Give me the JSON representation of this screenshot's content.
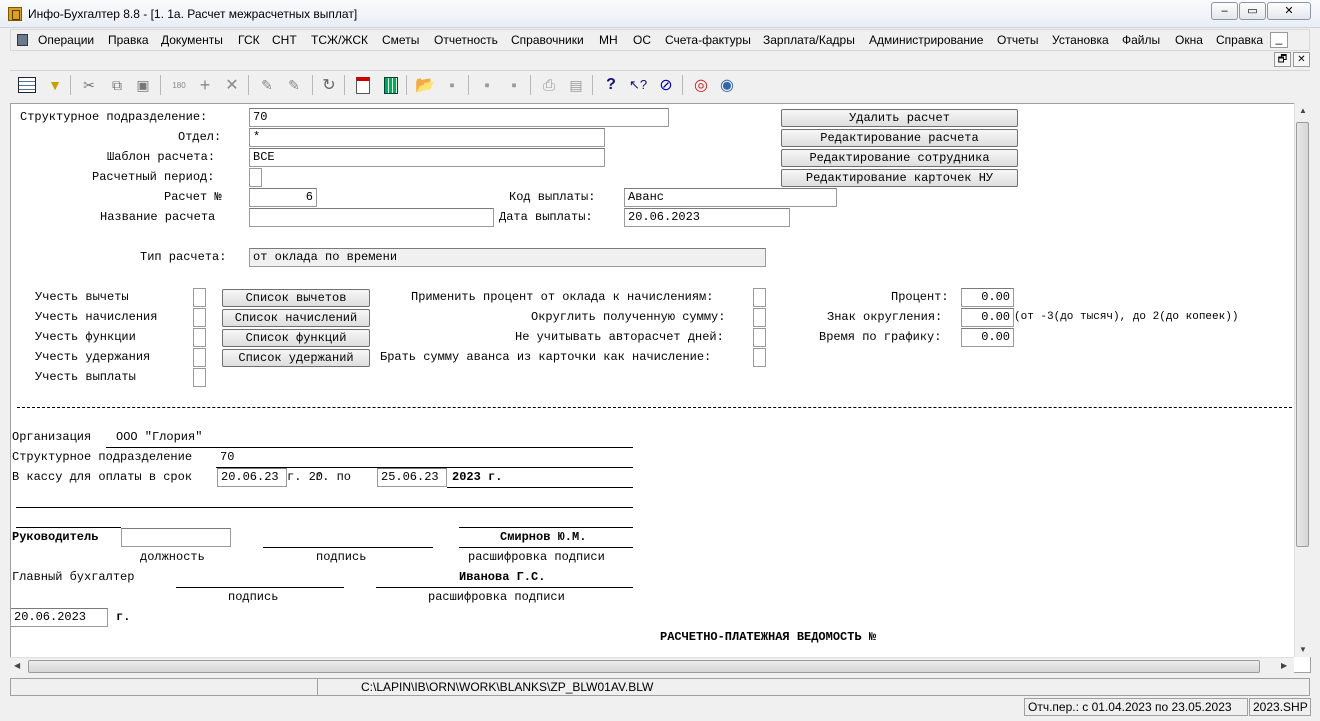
{
  "window": {
    "title": "Инфо-Бухгалтер 8.8 - [1. 1а. Расчет межрасчетных выплат]"
  },
  "menu": [
    "Операции",
    "Правка",
    "Документы",
    "ГСК",
    "СНТ",
    "ТСЖ/ЖСК",
    "Сметы",
    "Отчетность",
    "Справочники",
    "МН",
    "ОС",
    "Счета-фактуры",
    "Зарплата/Кадры",
    "Администрирование",
    "Отчеты",
    "Установка",
    "Файлы",
    "Окна",
    "Справка"
  ],
  "form": {
    "struct_label": "Структурное подразделение:",
    "struct_value": "70",
    "dept_label": "Отдел:",
    "dept_value": "*",
    "template_label": "Шаблон расчета:",
    "template_value": "ВСЕ",
    "period_label": "Расчетный период:",
    "calc_no_label": "Расчет №",
    "calc_no_value": "6",
    "calc_name_label": "Название расчета",
    "calc_name_value": "",
    "pay_code_label": "Код выплаты:",
    "pay_code_value": "Аванс",
    "pay_date_label": "Дата выплаты:",
    "pay_date_value": "20.06.2023",
    "calc_type_label": "Тип расчета:",
    "calc_type_value": "от оклада по времени",
    "opt_deductions": "Учесть вычеты",
    "opt_accruals": "Учесть начисления",
    "opt_functions": "Учесть функции",
    "opt_withholdings": "Учесть удержания",
    "opt_payments": "Учесть выплаты",
    "btn_deductions": "Список вычетов",
    "btn_accruals": "Список начислений",
    "btn_functions": "Список функций",
    "btn_withholdings": "Список удержаний",
    "apply_percent_label": "Применить процент от оклада к начислениям:",
    "round_sum_label": "Округлить полученную сумму:",
    "no_autocalc_label": "Не учитывать авторасчет дней:",
    "advance_card_label": "Брать сумму аванса из карточки как начисление:",
    "percent_label": "Процент:",
    "percent_value": "0.00",
    "round_sign_label": "Знак округления:",
    "round_sign_value": "0.00",
    "round_hint": "(от -3(до тысяч), до 2(до копеек))",
    "schedule_label": "Время по графику:",
    "schedule_value": "0.00",
    "btn_delete": "Удалить расчет",
    "btn_edit_calc": "Редактирование расчета",
    "btn_edit_emp": "Редактирование сотрудника",
    "btn_edit_cards": "Редактирование карточек НУ"
  },
  "blank": {
    "org_label": "Организация",
    "org_value": "ООО \"Глория\"",
    "struct_label": "Структурное подразделение",
    "struct_value": "70",
    "cash_label": "В кассу для оплаты в срок",
    "date_from": "20.06.23",
    "date_from_suffix": "г. 20",
    "date_mid": "по",
    "date_mid2": "г. по",
    "date_to": "25.06.23",
    "year_value": "2023 г.",
    "head_label": "Руководитель",
    "head_name": "Смирнов Ю.М.",
    "cap_position": "должность",
    "cap_signature": "подпись",
    "cap_decode": "расшифровка подписи",
    "chief_label": "Главный бухгалтер",
    "chief_name": "Иванова Г.С.",
    "cap_signature2": "подпись",
    "cap_decode2": "расшифровка подписи",
    "sign_date": "20.06.2023",
    "sign_date_suffix": "г.",
    "statement_title": "РАСЧЕТНО-ПЛАТЕЖНАЯ ВЕДОМОСТЬ №"
  },
  "status": {
    "path": "C:\\LAPIN\\IB\\ORN\\WORK\\BLANKS\\ZP_BLW01AV.BLW",
    "period": "Отч.пер.: с 01.04.2023 по 23.05.2023",
    "file": "2023.SHP"
  }
}
